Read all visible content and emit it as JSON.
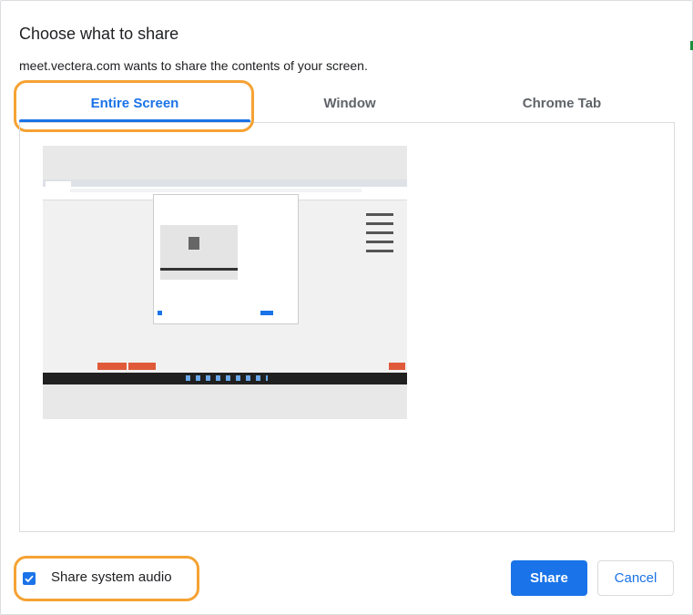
{
  "dialog": {
    "title": "Choose what to share",
    "subtitle": "meet.vectera.com wants to share the contents of your screen."
  },
  "tabs": [
    {
      "label": "Entire Screen",
      "active": true
    },
    {
      "label": "Window",
      "active": false
    },
    {
      "label": "Chrome Tab",
      "active": false
    }
  ],
  "audio": {
    "label": "Share system audio",
    "checked": true
  },
  "buttons": {
    "share": "Share",
    "cancel": "Cancel"
  },
  "colors": {
    "accent": "#1a73e8",
    "highlight": "#f5a233"
  },
  "icons": {
    "checkbox": "check-icon"
  }
}
